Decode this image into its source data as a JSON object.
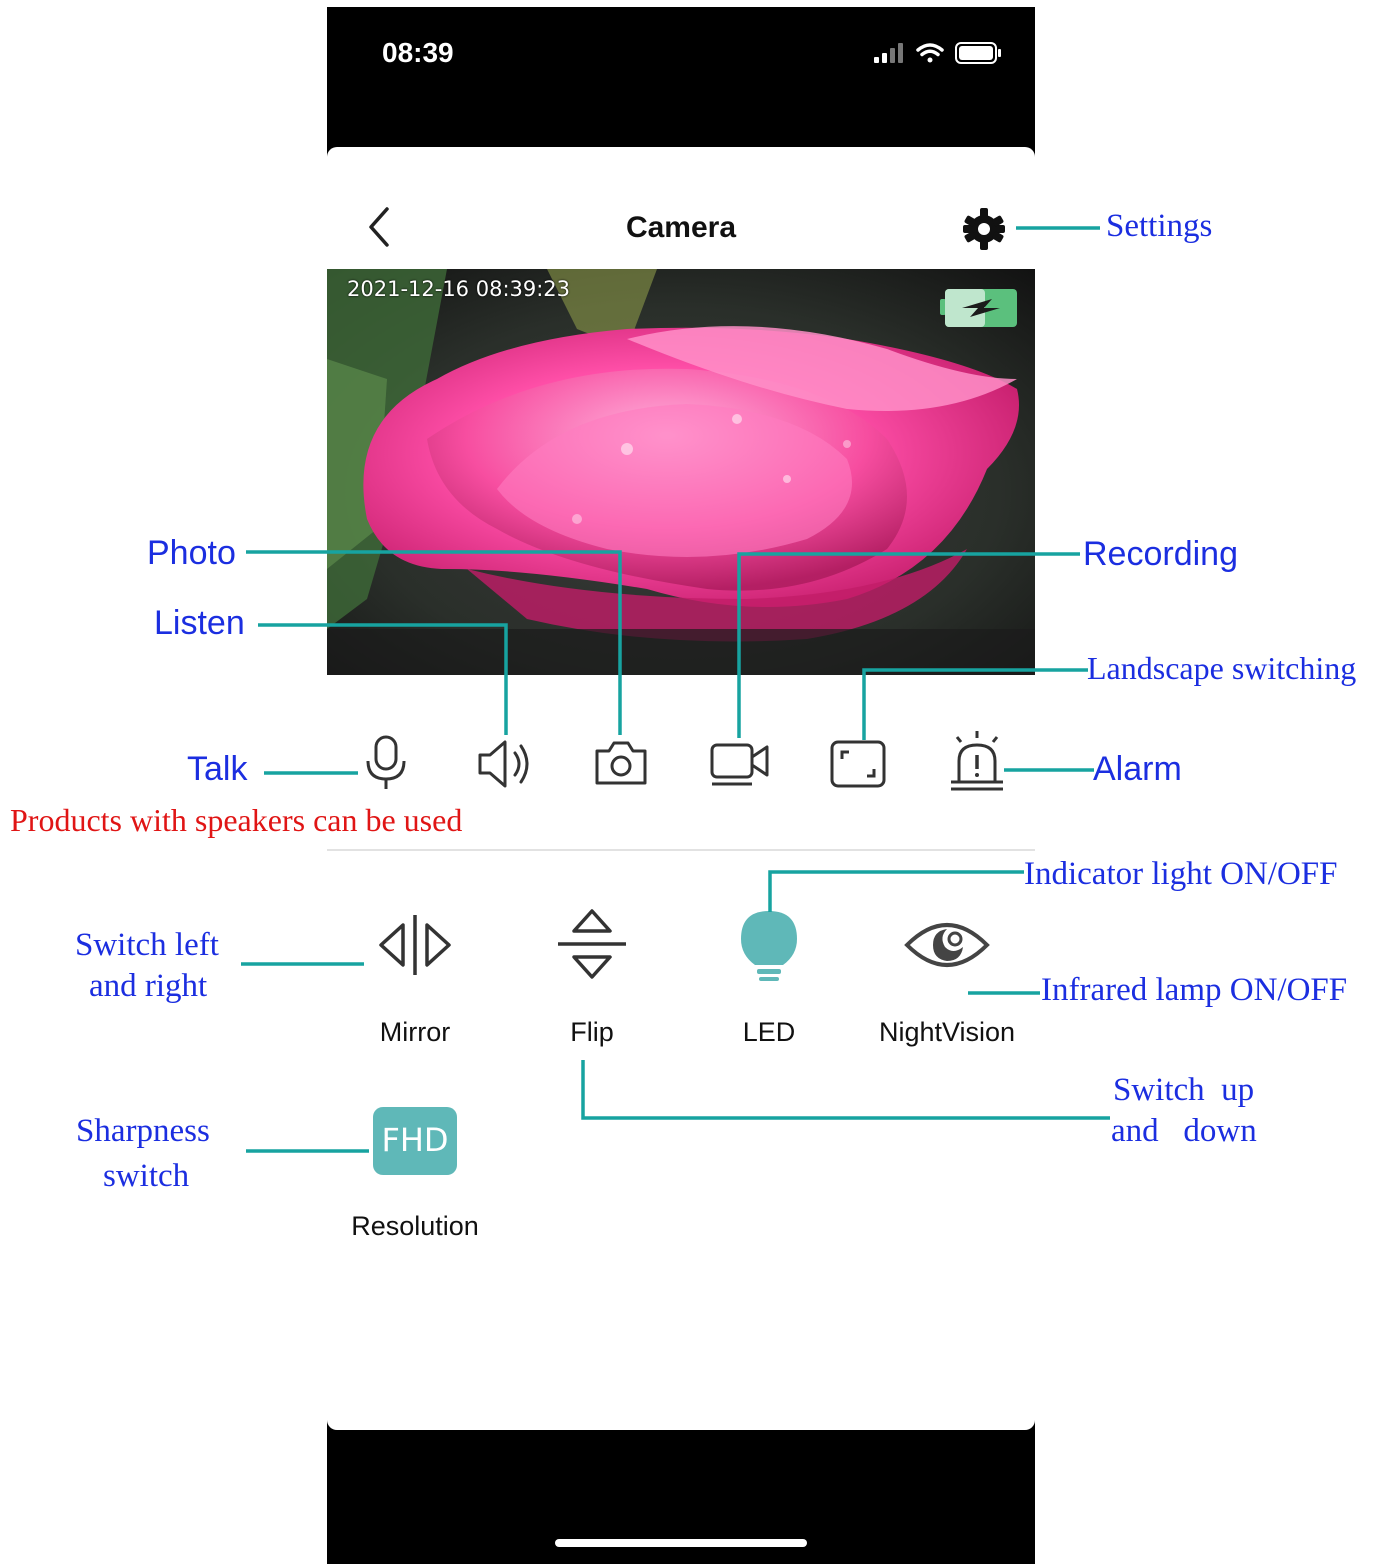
{
  "status_bar": {
    "time": "08:39"
  },
  "header": {
    "title": "Camera"
  },
  "video": {
    "timestamp": "2021-12-16 08:39:23"
  },
  "controls": {
    "talk_icon": "microphone-icon",
    "listen_icon": "speaker-icon",
    "photo_icon": "camera-icon",
    "record_icon": "video-camera-icon",
    "landscape_icon": "fullscreen-icon",
    "alarm_icon": "siren-icon"
  },
  "functions": {
    "mirror": "Mirror",
    "flip": "Flip",
    "led": "LED",
    "night_vision": "NightVision",
    "resolution_badge": "FHD",
    "resolution": "Resolution"
  },
  "annotations": {
    "settings": "Settings",
    "photo": "Photo",
    "recording": "Recording",
    "listen": "Listen",
    "landscape": "Landscape switching",
    "talk": "Talk",
    "alarm": "Alarm",
    "speaker_note": "Products with speakers can be used",
    "indicator": "Indicator light ON/OFF",
    "switch_lr_1": "Switch left",
    "switch_lr_2": "and right",
    "infrared": "Infrared lamp ON/OFF",
    "switch_ud_1": "Switch  up",
    "switch_ud_2": "and   down",
    "sharpness_1": "Sharpness",
    "sharpness_2": "switch"
  },
  "colors": {
    "accent_teal": "#5fb8b8",
    "leader_line": "#17a3a0",
    "annotation_blue": "#1b2ee0",
    "annotation_red": "#e01515",
    "battery_green": "#5bc07d"
  }
}
